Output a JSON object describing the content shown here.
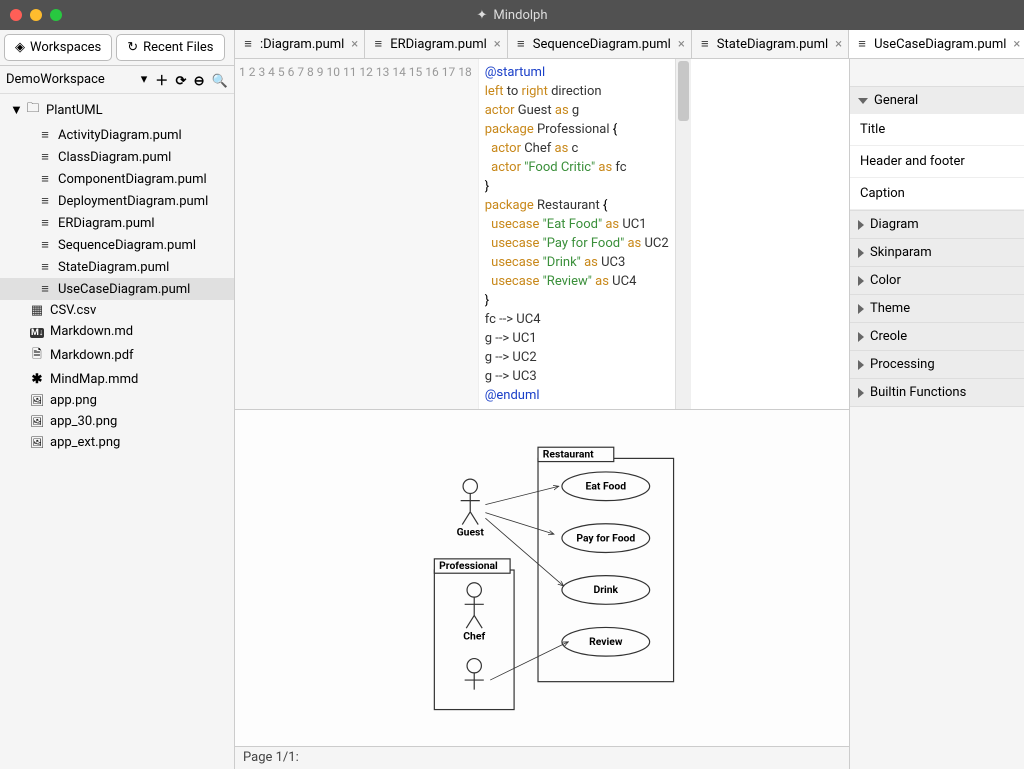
{
  "app": {
    "title": "Mindolph"
  },
  "sidebar": {
    "tabs": {
      "workspaces": "Workspaces",
      "recent": "Recent Files"
    },
    "workspace_name": "DemoWorkspace",
    "tree": {
      "folder": "PlantUML",
      "puml_files": [
        "ActivityDiagram.puml",
        "ClassDiagram.puml",
        "ComponentDiagram.puml",
        "DeploymentDiagram.puml",
        "ERDiagram.puml",
        "SequenceDiagram.puml",
        "StateDiagram.puml",
        "UseCaseDiagram.puml"
      ],
      "other_files": [
        {
          "name": "CSV.csv",
          "icon": "csv"
        },
        {
          "name": "Markdown.md",
          "icon": "md"
        },
        {
          "name": "Markdown.pdf",
          "icon": "pdf"
        },
        {
          "name": "MindMap.mmd",
          "icon": "mm"
        },
        {
          "name": "app.png",
          "icon": "png"
        },
        {
          "name": "app_30.png",
          "icon": "png"
        },
        {
          "name": "app_ext.png",
          "icon": "png"
        }
      ]
    }
  },
  "tabs": [
    {
      "label": ":Diagram.puml",
      "active": false
    },
    {
      "label": "ERDiagram.puml",
      "active": false
    },
    {
      "label": "SequenceDiagram.puml",
      "active": false
    },
    {
      "label": "StateDiagram.puml",
      "active": false
    },
    {
      "label": "UseCaseDiagram.puml",
      "active": true
    }
  ],
  "code_lines": [
    {
      "n": 1,
      "html": "<span class='dir'>@startuml</span>"
    },
    {
      "n": 2,
      "html": "<span class='kw'>left</span> <span class='id'>to</span> <span class='kw'>right</span> <span class='id'>direction</span>"
    },
    {
      "n": 3,
      "html": "<span class='kw'>actor</span> <span class='id'>Guest</span> <span class='as'>as</span> <span class='id'>g</span>"
    },
    {
      "n": 4,
      "html": "<span class='kw'>package</span> <span class='id'>Professional</span> {"
    },
    {
      "n": 5,
      "html": "  <span class='kw'>actor</span> <span class='id'>Chef</span> <span class='as'>as</span> <span class='id'>c</span>"
    },
    {
      "n": 6,
      "html": "  <span class='kw'>actor</span> <span class='str'>\"Food Critic\"</span> <span class='as'>as</span> <span class='id'>fc</span>"
    },
    {
      "n": 7,
      "html": "}"
    },
    {
      "n": 8,
      "html": "<span class='kw'>package</span> <span class='id'>Restaurant</span> {"
    },
    {
      "n": 9,
      "html": "  <span class='kw'>usecase</span> <span class='str'>\"Eat Food\"</span> <span class='as'>as</span> <span class='id'>UC1</span>"
    },
    {
      "n": 10,
      "html": "  <span class='kw'>usecase</span> <span class='str'>\"Pay for Food\"</span> <span class='as'>as</span> <span class='id'>UC2</span>"
    },
    {
      "n": 11,
      "html": "  <span class='kw'>usecase</span> <span class='str'>\"Drink\"</span> <span class='as'>as</span> <span class='id'>UC3</span>"
    },
    {
      "n": 12,
      "html": "  <span class='kw'>usecase</span> <span class='str'>\"Review\"</span> <span class='as'>as</span> <span class='id'>UC4</span>"
    },
    {
      "n": 13,
      "html": "}"
    },
    {
      "n": 14,
      "html": "<span class='id'>fc --&gt; UC4</span>"
    },
    {
      "n": 15,
      "html": "<span class='id'>g --&gt; UC1</span>"
    },
    {
      "n": 16,
      "html": "<span class='id'>g --&gt; UC2</span>"
    },
    {
      "n": 17,
      "html": "<span class='id'>g --&gt; UC3</span>"
    },
    {
      "n": 18,
      "html": "<span class='dir'>@enduml</span>"
    }
  ],
  "inspector": {
    "general": {
      "title": "General",
      "items": [
        "Title",
        "Header and footer",
        "Caption"
      ]
    },
    "collapsed": [
      "Diagram",
      "Skinparam",
      "Color",
      "Theme",
      "Creole",
      "Processing",
      "Builtin Functions"
    ]
  },
  "preview": {
    "restaurant_label": "Restaurant",
    "professional_label": "Professional",
    "guest": "Guest",
    "chef": "Chef",
    "usecases": [
      "Eat Food",
      "Pay for Food",
      "Drink",
      "Review"
    ]
  },
  "status": {
    "page": "Page 1/1:"
  }
}
